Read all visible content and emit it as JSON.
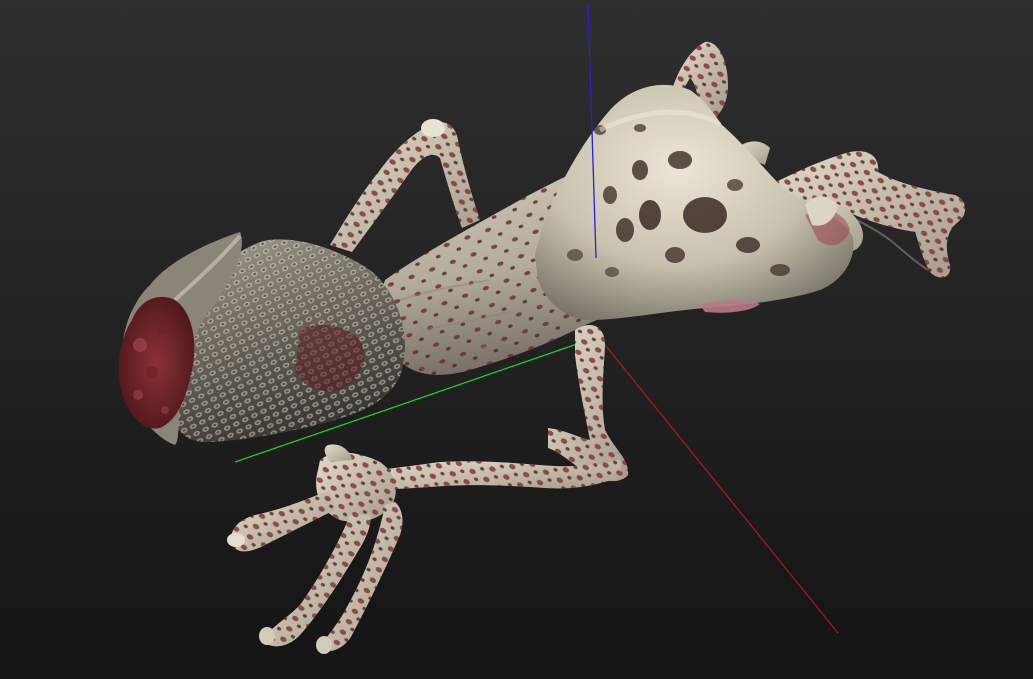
{
  "viewport": {
    "background_top": "#2f2f2f",
    "background_bottom": "#141414"
  },
  "axes": {
    "x_color": "#b01515",
    "y_color": "#1ccf1c",
    "z_color": "#2323d8"
  },
  "model": {
    "skin_color": "#c8c1ad",
    "skin_highlight": "#e6e0cf",
    "skin_shadow": "#6f6a60",
    "flesh_color": "#7a2a2e",
    "flesh_dark": "#4a1518",
    "pit_color": "#3a2a26"
  }
}
